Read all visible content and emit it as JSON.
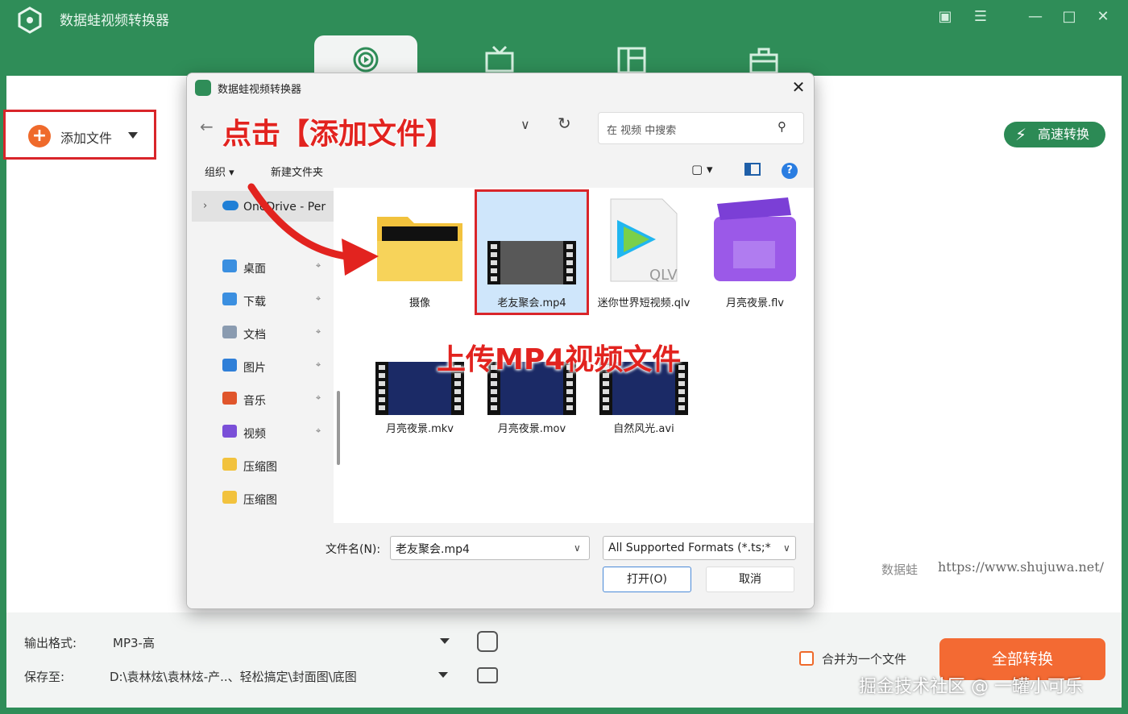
{
  "app": {
    "title": "数据蛙视频转换器"
  },
  "toolbar": {
    "add_file_label": "添加文件",
    "turbo_label": "高速转换"
  },
  "watermark": {
    "brand": "数据蛙",
    "url": "https://www.shujuwa.net/"
  },
  "bottom": {
    "output_format_label": "输出格式:",
    "output_format_value": "MP3-高",
    "save_to_label": "保存至:",
    "save_to_value": "D:\\袁林炫\\袁林炫-产..、轻松搞定\\封面图\\底图",
    "merge_label": "合并为一个文件",
    "convert_all_label": "全部转换"
  },
  "credit": "掘金技术社区 @ 一罐小可乐",
  "dialog": {
    "title": "数据蛙视频转换器",
    "close": "✕",
    "address_annotation": "点击【添加文件】",
    "search_placeholder": "在 视频 中搜索",
    "organize_label": "组织 ▾",
    "new_folder_label": "新建文件夹",
    "help": "?",
    "nav": {
      "onedrive": "OneDrive - Per",
      "items": [
        {
          "label": "桌面",
          "icon": "desktop-icon",
          "color": "#3b8fe0",
          "pinned": true
        },
        {
          "label": "下载",
          "icon": "download-icon",
          "color": "#3b8fe0",
          "pinned": true
        },
        {
          "label": "文档",
          "icon": "document-icon",
          "color": "#8a9bb0",
          "pinned": true
        },
        {
          "label": "图片",
          "icon": "pictures-icon",
          "color": "#2f7fd8",
          "pinned": true
        },
        {
          "label": "音乐",
          "icon": "music-icon",
          "color": "#e0552b",
          "pinned": true
        },
        {
          "label": "视频",
          "icon": "videos-icon",
          "color": "#7a4fd8",
          "pinned": true
        },
        {
          "label": "压缩图",
          "icon": "folder-icon",
          "color": "#f2c23d",
          "pinned": false
        },
        {
          "label": "压缩图",
          "icon": "folder-icon",
          "color": "#f2c23d",
          "pinned": false
        }
      ]
    },
    "files": [
      {
        "name": "摄像",
        "kind": "folder"
      },
      {
        "name": "老友聚会.mp4",
        "kind": "video"
      },
      {
        "name": "迷你世界短视频.qlv",
        "kind": "qlv"
      },
      {
        "name": "月亮夜景.flv",
        "kind": "flv"
      },
      {
        "name": "月亮夜景.mkv",
        "kind": "video"
      },
      {
        "name": "月亮夜景.mov",
        "kind": "video"
      },
      {
        "name": "自然风光.avi",
        "kind": "video"
      }
    ],
    "upload_annotation": "上传MP4视频文件",
    "qlv_badge": "QLV",
    "filename_label": "文件名(N):",
    "filename_value": "老友聚会.mp4",
    "format_value": "All Supported Formats (*.ts;*",
    "open_label": "打开(O)",
    "cancel_label": "取消"
  },
  "colors": {
    "brand_green": "#2f8d58",
    "accent_orange": "#f36a33",
    "annotation_red": "#e2231f"
  }
}
